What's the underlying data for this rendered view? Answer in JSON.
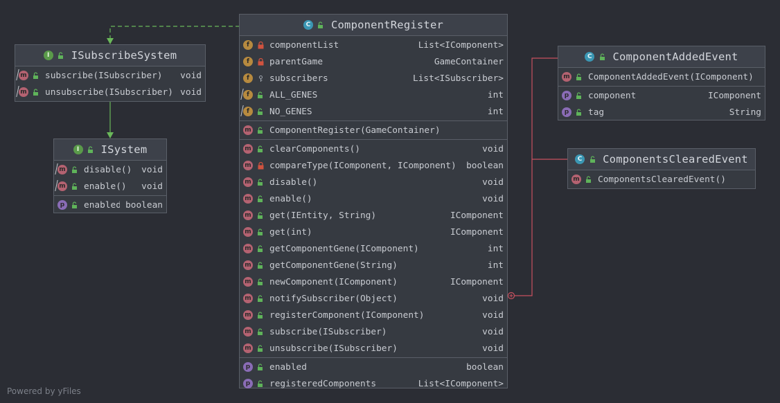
{
  "classes": {
    "component_register": {
      "kind": "C",
      "name": "ComponentRegister",
      "fields": [
        {
          "name": "componentList",
          "type": "List<IComponent>",
          "kind": "f",
          "visibility": "private"
        },
        {
          "name": "parentGame",
          "type": "GameContainer",
          "kind": "f",
          "visibility": "private"
        },
        {
          "name": "subscribers",
          "type": "List<ISubscriber>",
          "kind": "f",
          "visibility": "package"
        },
        {
          "name": "ALL_GENES",
          "type": "int",
          "kind": "f",
          "visibility": "public"
        },
        {
          "name": "NO_GENES",
          "type": "int",
          "kind": "f",
          "visibility": "public"
        }
      ],
      "constructors": [
        {
          "name": "ComponentRegister(GameContainer)",
          "type": "",
          "kind": "m",
          "visibility": "public"
        }
      ],
      "methods": [
        {
          "name": "clearComponents()",
          "type": "void",
          "kind": "m",
          "visibility": "public"
        },
        {
          "name": "compareType(IComponent, IComponent)",
          "type": "boolean",
          "kind": "m",
          "visibility": "private"
        },
        {
          "name": "disable()",
          "type": "void",
          "kind": "m",
          "visibility": "public"
        },
        {
          "name": "enable()",
          "type": "void",
          "kind": "m",
          "visibility": "public"
        },
        {
          "name": "get(IEntity, String)",
          "type": "IComponent",
          "kind": "m",
          "visibility": "public"
        },
        {
          "name": "get(int)",
          "type": "IComponent",
          "kind": "m",
          "visibility": "public"
        },
        {
          "name": "getComponentGene(IComponent)",
          "type": "int",
          "kind": "m",
          "visibility": "public"
        },
        {
          "name": "getComponentGene(String)",
          "type": "int",
          "kind": "m",
          "visibility": "public"
        },
        {
          "name": "newComponent(IComponent)",
          "type": "IComponent",
          "kind": "m",
          "visibility": "public"
        },
        {
          "name": "notifySubscriber(Object)",
          "type": "void",
          "kind": "m",
          "visibility": "public"
        },
        {
          "name": "registerComponent(IComponent)",
          "type": "void",
          "kind": "m",
          "visibility": "public"
        },
        {
          "name": "subscribe(ISubscriber)",
          "type": "void",
          "kind": "m",
          "visibility": "public"
        },
        {
          "name": "unsubscribe(ISubscriber)",
          "type": "void",
          "kind": "m",
          "visibility": "public"
        }
      ],
      "properties": [
        {
          "name": "enabled",
          "type": "boolean",
          "kind": "p",
          "visibility": "public"
        },
        {
          "name": "registeredComponents",
          "type": "List<IComponent>",
          "kind": "p",
          "visibility": "public"
        }
      ]
    },
    "isubscribe_system": {
      "kind": "I",
      "name": "ISubscribeSystem",
      "methods": [
        {
          "name": "subscribe(ISubscriber)",
          "type": "void",
          "kind": "m",
          "visibility": "public"
        },
        {
          "name": "unsubscribe(ISubscriber)",
          "type": "void",
          "kind": "m",
          "visibility": "public"
        }
      ]
    },
    "isystem": {
      "kind": "I",
      "name": "ISystem",
      "methods": [
        {
          "name": "disable()",
          "type": "void",
          "kind": "m",
          "visibility": "public"
        },
        {
          "name": "enable()",
          "type": "void",
          "kind": "m",
          "visibility": "public"
        }
      ],
      "properties": [
        {
          "name": "enabled",
          "type": "boolean",
          "kind": "p",
          "visibility": "public"
        }
      ]
    },
    "component_added_event": {
      "kind": "C",
      "name": "ComponentAddedEvent",
      "constructors": [
        {
          "name": "ComponentAddedEvent(IComponent)",
          "type": "",
          "kind": "m",
          "visibility": "public"
        }
      ],
      "properties": [
        {
          "name": "component",
          "type": "IComponent",
          "kind": "p",
          "visibility": "public"
        },
        {
          "name": "tag",
          "type": "String",
          "kind": "p",
          "visibility": "public"
        }
      ]
    },
    "components_cleared_event": {
      "kind": "C",
      "name": "ComponentsClearedEvent",
      "constructors": [
        {
          "name": "ComponentsClearedEvent()",
          "type": "",
          "kind": "m",
          "visibility": "public"
        }
      ]
    }
  },
  "footer": {
    "powered_by": "Powered by yFiles"
  },
  "colors": {
    "background": "#2b2d34",
    "box": "#363a41",
    "border": "#5a5f68",
    "realization_edge": "#6ab85a",
    "inner_class_edge": "#c8515f"
  }
}
